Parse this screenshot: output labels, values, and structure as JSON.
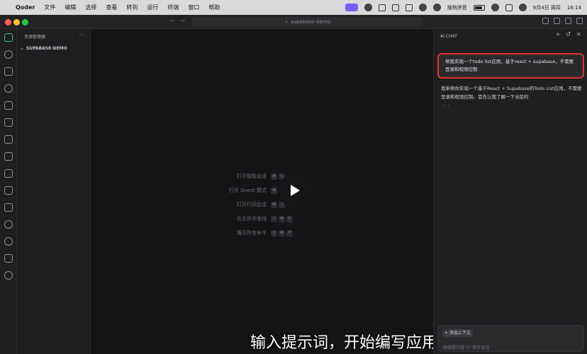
{
  "menubar": {
    "app_name": "Qoder",
    "items": [
      "文件",
      "编辑",
      "选择",
      "查看",
      "转到",
      "运行",
      "终端",
      "窗口",
      "帮助"
    ],
    "ime": "搜狗拼音",
    "datetime": "9月4日 周四",
    "time": "16:14"
  },
  "titlebar": {
    "search_text": "supabase-demo"
  },
  "activitybar": {
    "icons": [
      "explorer-icon",
      "search-icon",
      "source-control-icon",
      "compass-icon",
      "extensions-cube-icon",
      "run-debug-icon",
      "grid-icon",
      "remote-icon",
      "flask-icon",
      "layers-icon",
      "folder-icon",
      "git-icon",
      "sync-icon",
      "puzzle-icon",
      "hexagon-icon"
    ]
  },
  "sidebar": {
    "title": "资源管理器",
    "more": "···",
    "root_folder": "SUPABASE-DEMO"
  },
  "editor": {
    "shortcuts": [
      {
        "label": "打开智能会话",
        "keys": [
          "⌘",
          "L"
        ]
      },
      {
        "label": "打开 Quest 模式",
        "keys": [
          "⌘",
          "E"
        ]
      },
      {
        "label": "打开行间会话",
        "keys": [
          "⌘",
          "I"
        ]
      },
      {
        "label": "在文件中查找",
        "keys": [
          "⇧",
          "⌘",
          "F"
        ]
      },
      {
        "label": "展示所有命令",
        "keys": [
          "⇧",
          "⌘",
          "P"
        ]
      }
    ],
    "subtitle": "输入提示词，开始编写应用"
  },
  "chat": {
    "title": "AI CHAT",
    "user_message": "帮我实现一个todo list应用，基于react + supabase，不需要登录和权限控制",
    "assistant_message": "我来帮你实现一个基于React + Supabase的Todo List应用，不需要登录和权限控制。首先让我了解一下当前的",
    "assistant_dots": "···",
    "add_context_label": "+ 添加上下文",
    "input_placeholder": "继续提问或 \"/\" 新开会话"
  },
  "colors": {
    "highlight_border": "#e3322e",
    "accent_green": "#2fc27a"
  }
}
